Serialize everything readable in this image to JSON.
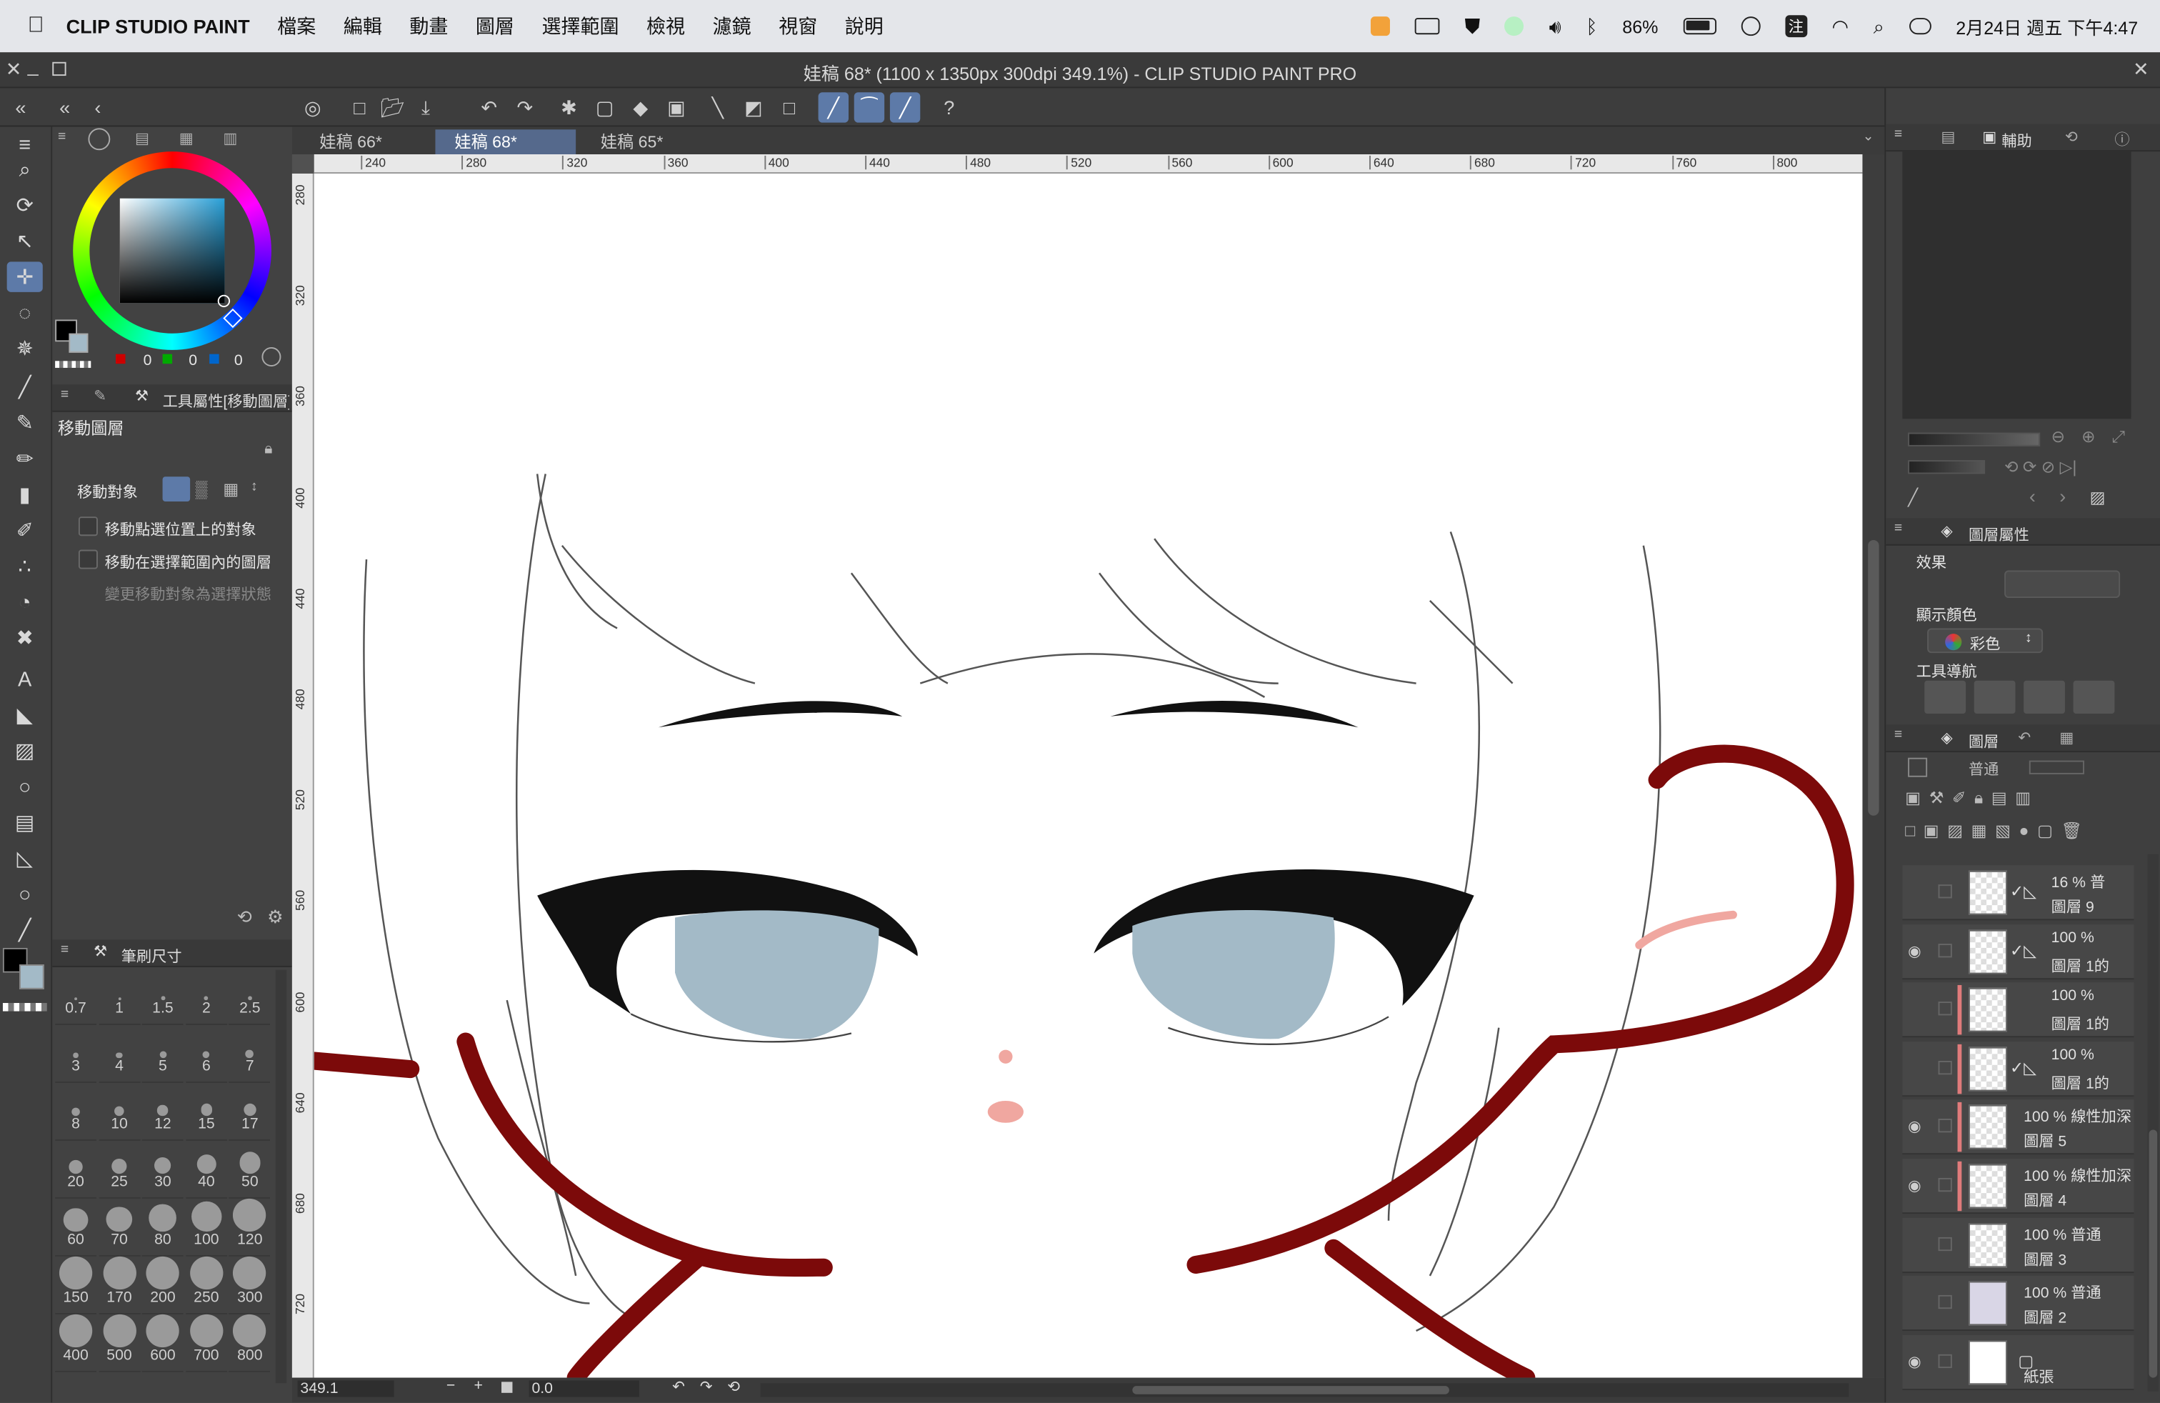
{
  "menubar": {
    "apple": "",
    "app": "CLIP STUDIO PAINT",
    "items": [
      "檔案",
      "編輯",
      "動畫",
      "圖層",
      "選擇範圍",
      "檢視",
      "濾鏡",
      "視窗",
      "說明"
    ],
    "battery": "86%",
    "clock": "2月24日 週五 下午4:47",
    "ime": "注"
  },
  "window": {
    "title": "娃稿 68* (1100 x 1350px 300dpi 349.1%)  - CLIP STUDIO PAINT PRO"
  },
  "color": {
    "r": "0",
    "g": "0",
    "b": "0"
  },
  "tool_property": {
    "header": "工具屬性[移動圖層]",
    "tool_name": "移動圖層",
    "target_label": "移動對象",
    "opt1": "移動點選位置上的對象",
    "opt2": "移動在選擇範圍內的圖層",
    "opt3": "變更移動對象為選擇狀態"
  },
  "brush_size": {
    "header": "筆刷尺寸",
    "sizes": [
      "0.7",
      "1",
      "1.5",
      "2",
      "2.5",
      "3",
      "4",
      "5",
      "6",
      "7",
      "8",
      "10",
      "12",
      "15",
      "17",
      "20",
      "25",
      "30",
      "40",
      "50",
      "60",
      "70",
      "80",
      "100",
      "120",
      "150",
      "170",
      "200",
      "250",
      "300",
      "400",
      "500",
      "600",
      "700",
      "800"
    ]
  },
  "tabs": [
    "娃稿 66*",
    "娃稿 68*",
    "娃稿 65*"
  ],
  "ruler_top": [
    "240",
    "280",
    "320",
    "360",
    "400",
    "440",
    "480",
    "520",
    "560",
    "600",
    "640",
    "680",
    "720",
    "760",
    "800"
  ],
  "ruler_left": [
    "280",
    "320",
    "360",
    "400",
    "440",
    "480",
    "520",
    "560",
    "600",
    "640",
    "680",
    "720"
  ],
  "status": {
    "zoom": "349.1",
    "angle": "0.0"
  },
  "right": {
    "assist_tab": "輔助",
    "layer_prop_tab": "圖層屬性",
    "effect_label": "效果",
    "display_color_label": "顯示顏色",
    "display_color_value": "彩色",
    "tool_nav_label": "工具導航",
    "layers_tab": "圖層",
    "blend_mode": "普通"
  },
  "layers": [
    {
      "pct": "16 %",
      "mode": "普",
      "name": "圖層 9"
    },
    {
      "pct": "100 %",
      "mode": "",
      "name": "圖層 1的"
    },
    {
      "pct": "100 %",
      "mode": "",
      "name": "圖層 1的"
    },
    {
      "pct": "100 %",
      "mode": "",
      "name": "圖層 1的"
    },
    {
      "pct": "100 %",
      "mode": "線性加深",
      "name": "圖層 5"
    },
    {
      "pct": "100 %",
      "mode": "線性加深",
      "name": "圖層 4"
    },
    {
      "pct": "100 %",
      "mode": "普通",
      "name": "圖層 3"
    },
    {
      "pct": "100 %",
      "mode": "普通",
      "name": "圖層 2"
    },
    {
      "pct": "",
      "mode": "",
      "name": "紙張"
    }
  ],
  "colors": {
    "accent": "#5d7aa8",
    "hair_red": "#7c0a0a",
    "iris": "#a3bac7",
    "blush": "#f0a7a0"
  }
}
